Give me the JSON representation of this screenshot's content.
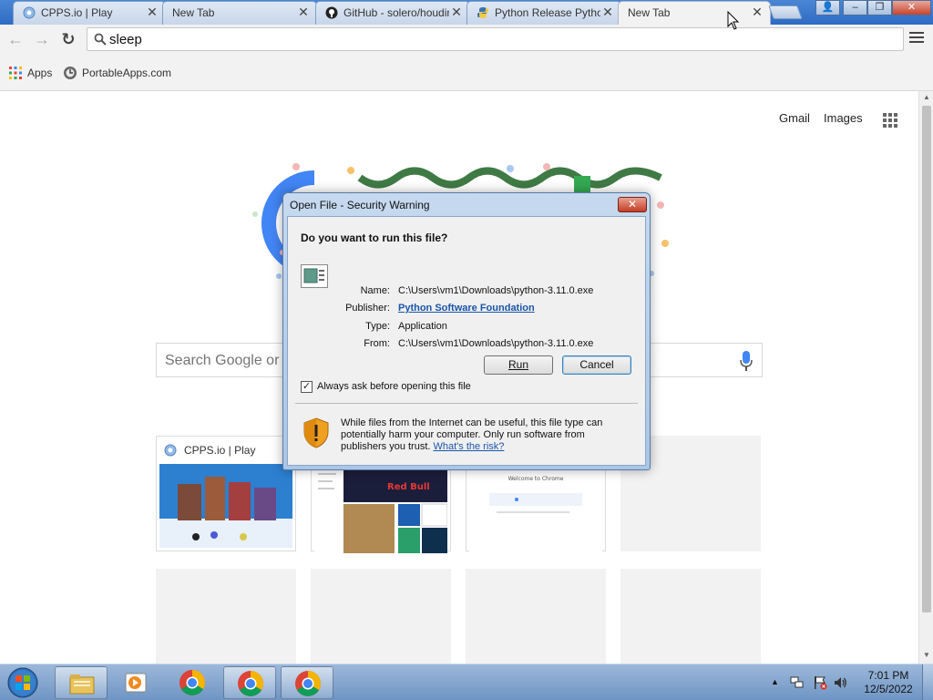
{
  "browser": {
    "tabs": [
      {
        "title": "CPPS.io | Play",
        "active": false,
        "favicon": "cpps-icon"
      },
      {
        "title": "New Tab",
        "active": false,
        "favicon": "none"
      },
      {
        "title": "GitHub - solero/houdini",
        "active": false,
        "favicon": "github-icon"
      },
      {
        "title": "Python Release Python",
        "active": false,
        "favicon": "python-icon"
      },
      {
        "title": "New Tab",
        "active": true,
        "favicon": "none"
      }
    ],
    "tab_close_glyph": "✕",
    "window_controls": {
      "user": "👤",
      "minimize": "–",
      "restore": "❐",
      "close": "✕"
    },
    "nav": {
      "back": "←",
      "forward": "→",
      "reload": "↻"
    },
    "omnibox_value": "sleep",
    "bookmarks": [
      {
        "label": "Apps",
        "icon": "apps-grid-icon"
      },
      {
        "label": "PortableApps.com",
        "icon": "portableapps-icon"
      }
    ]
  },
  "newtab": {
    "top_links": {
      "gmail": "Gmail",
      "images": "Images"
    },
    "search_placeholder": "Search Google or type URL",
    "tiles": [
      {
        "title": "CPPS.io | Play",
        "filled": true
      },
      {
        "title": "",
        "filled": true
      },
      {
        "title": "",
        "filled": true
      },
      {
        "title": "",
        "filled": false
      },
      {
        "title": "",
        "filled": false
      },
      {
        "title": "",
        "filled": false
      },
      {
        "title": "",
        "filled": false
      },
      {
        "title": "",
        "filled": false
      }
    ],
    "welcome_thumb_text": "Welcome to Chrome"
  },
  "dialog": {
    "title": "Open File - Security Warning",
    "question": "Do you want to run this file?",
    "labels": {
      "name": "Name:",
      "publisher": "Publisher:",
      "type": "Type:",
      "from": "From:"
    },
    "values": {
      "name": "C:\\Users\\vm1\\Downloads\\python-3.11.0.exe",
      "publisher": "Python Software Foundation",
      "type": "Application",
      "from": "C:\\Users\\vm1\\Downloads\\python-3.11.0.exe"
    },
    "run_label": "Run",
    "cancel_label": "Cancel",
    "checkbox_label": "Always ask before opening this file",
    "checkbox_checked": true,
    "warning_text": "While files from the Internet can be useful, this file type can potentially harm your computer. Only run software from publishers you trust.",
    "warning_link": "What's the risk?",
    "close_glyph": "✕"
  },
  "taskbar": {
    "time": "7:01 PM",
    "date": "12/5/2022",
    "tray_up_glyph": "▲"
  },
  "colors": {
    "google_blue": "#4285f4",
    "doodle_green": "#3f7a45",
    "link_blue": "#1a56a8"
  }
}
